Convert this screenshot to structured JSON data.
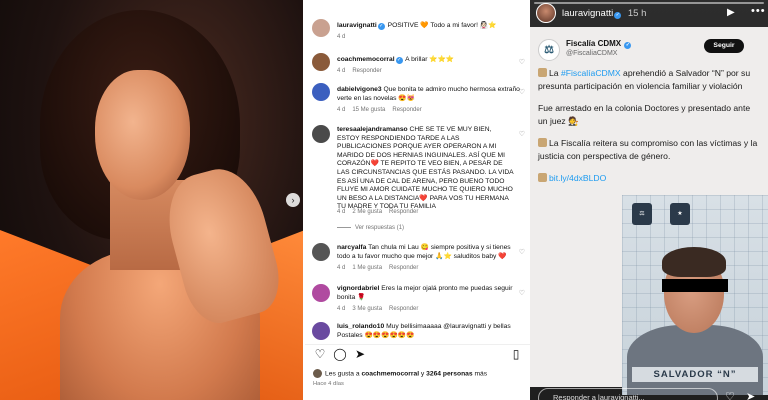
{
  "photo": {
    "next_icon": "chevron-right-icon",
    "next_glyph": "›"
  },
  "comments": [
    {
      "user": "lauravignatti",
      "verified": true,
      "text": "POSITIVE 🧡 Todo a mi favor! 👰🏻⭐",
      "age": "4 d",
      "reply": "",
      "likes": "",
      "avatar_color": "#c9a190"
    },
    {
      "user": "coachmemocorral",
      "verified": true,
      "text": "A brillar ⭐⭐⭐",
      "age": "4 d",
      "reply": "Responder",
      "likes": "",
      "avatar_color": "#8a5a3a"
    },
    {
      "user": "dabielvigone3",
      "verified": false,
      "text": "Que bonita te admiro mucho hermosa extraño verte en las novelas 😍😻",
      "age": "4 d",
      "reply": "Responder",
      "likes": "15 Me gusta",
      "avatar_color": "#3b5fbf"
    },
    {
      "user": "teresaalejandramanso",
      "verified": false,
      "text": "CHE SE TE VE MUY BIEN, ESTOY RESPONDIENDO TARDE A LAS PUBLICACIONES PORQUE AYER OPERARON A MI MARIDO DE DOS HERNIAS INGUINALES. ASÍ QUE MI CORAZÓN❤️ TE REPITO TE VEO BIEN, A PESAR DE LAS CIRCUNSTANCIAS QUE ESTÁS PASANDO. LA VIDA ES ASÍ UNA DE CAL DE ARENA, PERO BUENO TODO FLUYE MI AMOR CUIDATE MUCHO TE QUIERO MUCHO UN BESO A LA DISTANCIA❤️ PARA VOS TU HERMANA TU MADRE Y TODA TU FAMILIA",
      "age": "4 d",
      "reply": "Responder",
      "likes": "2 Me gusta",
      "avatar_color": "#4a4a4a"
    },
    {
      "user": "narcyalfa",
      "verified": false,
      "text": "Tan chula mi Lau 😋 siempre positiva y si tienes todo a tu favor mucho que mejor 🙏⭐ saluditos baby ❤️",
      "age": "4 d",
      "reply": "Responder",
      "likes": "1 Me gusta",
      "avatar_color": "#555"
    },
    {
      "user": "vignordabriel",
      "verified": false,
      "text": "Eres la mejor ojalá pronto me puedas seguir bonita 🌹",
      "age": "4 d",
      "reply": "Responder",
      "likes": "3 Me gusta",
      "avatar_color": "#b04aa0"
    },
    {
      "user": "luis_rolando10",
      "verified": false,
      "text": "Muy bellisimaaaaa @lauravignatti y bellas Postales 😍😍😍😍😍😍",
      "age": "",
      "reply": "",
      "likes": "",
      "avatar_color": "#6a4aa0"
    }
  ],
  "view_replies": "Ver respuestas (1)",
  "likes_line": {
    "prefix": "Les gusta a ",
    "user": "coachmemocorral",
    "middle": " y ",
    "count": "3264 personas",
    "suffix": " más"
  },
  "post_date": "Hace 4 días",
  "action_icons": [
    "heart-icon",
    "comment-icon",
    "share-icon",
    "bookmark-icon"
  ],
  "story": {
    "user": "lauravignatti",
    "time": "15 h",
    "tweet": {
      "name": "Fiscalía CDMX",
      "handle": "@FiscaliaCDMX",
      "follow": "Seguir",
      "p1_pre": "La ",
      "p1_tag": "#FiscalíaCDMX",
      "p1_post": " aprehendió a Salvador “N” por su presunta participación en violencia familiar y violación",
      "p2": "Fue arrestado en la colonia Doctores y presentado ante un juez 🧑‍⚖️",
      "p3": "La Fiscalía reitera su compromiso con las víctimas y la justicia con perspectiva de género.",
      "link": "bit.ly/4dxBLDO",
      "plate": "SALVADOR “N”"
    },
    "reply_placeholder": "Responder a lauravignatti..."
  }
}
